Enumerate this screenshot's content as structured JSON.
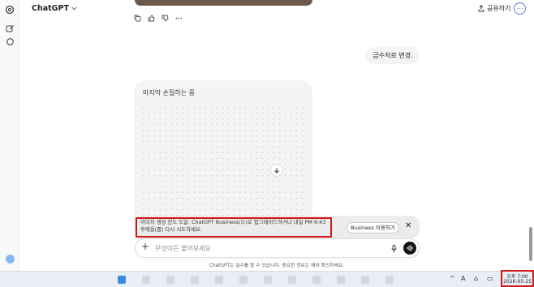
{
  "header": {
    "model_name": "ChatGPT",
    "share_label": "공유하기",
    "profile_initial": "…"
  },
  "conversation": {
    "user_message": "금수저로 변경.",
    "generating_label": "마지막 손질하는 중"
  },
  "limit_banner": {
    "line1": "이미지 생성 한도 도달. ChatGPT Business(으)로 업그레이드하거나 내일 PM 6:43",
    "line2": "후에을(를) 다시 시도하세요.",
    "upgrade_button": "Business 이용하기",
    "close_glyph": "✕"
  },
  "composer": {
    "plus_glyph": "+",
    "placeholder": "무엇이든 물어보세요"
  },
  "disclaimer": "ChatGPT는 실수를 할 수 있습니다. 중요한 정보는 재차 확인하세요.",
  "taskbar": {
    "time": "오후 7:00",
    "date": "2026-05-25",
    "tray_glyphs": [
      "^",
      "A",
      "⌂",
      "▭"
    ]
  },
  "colors": {
    "highlight_red": "#d01919",
    "accent_blue": "#4f79d8",
    "voice_button": "#111111"
  }
}
